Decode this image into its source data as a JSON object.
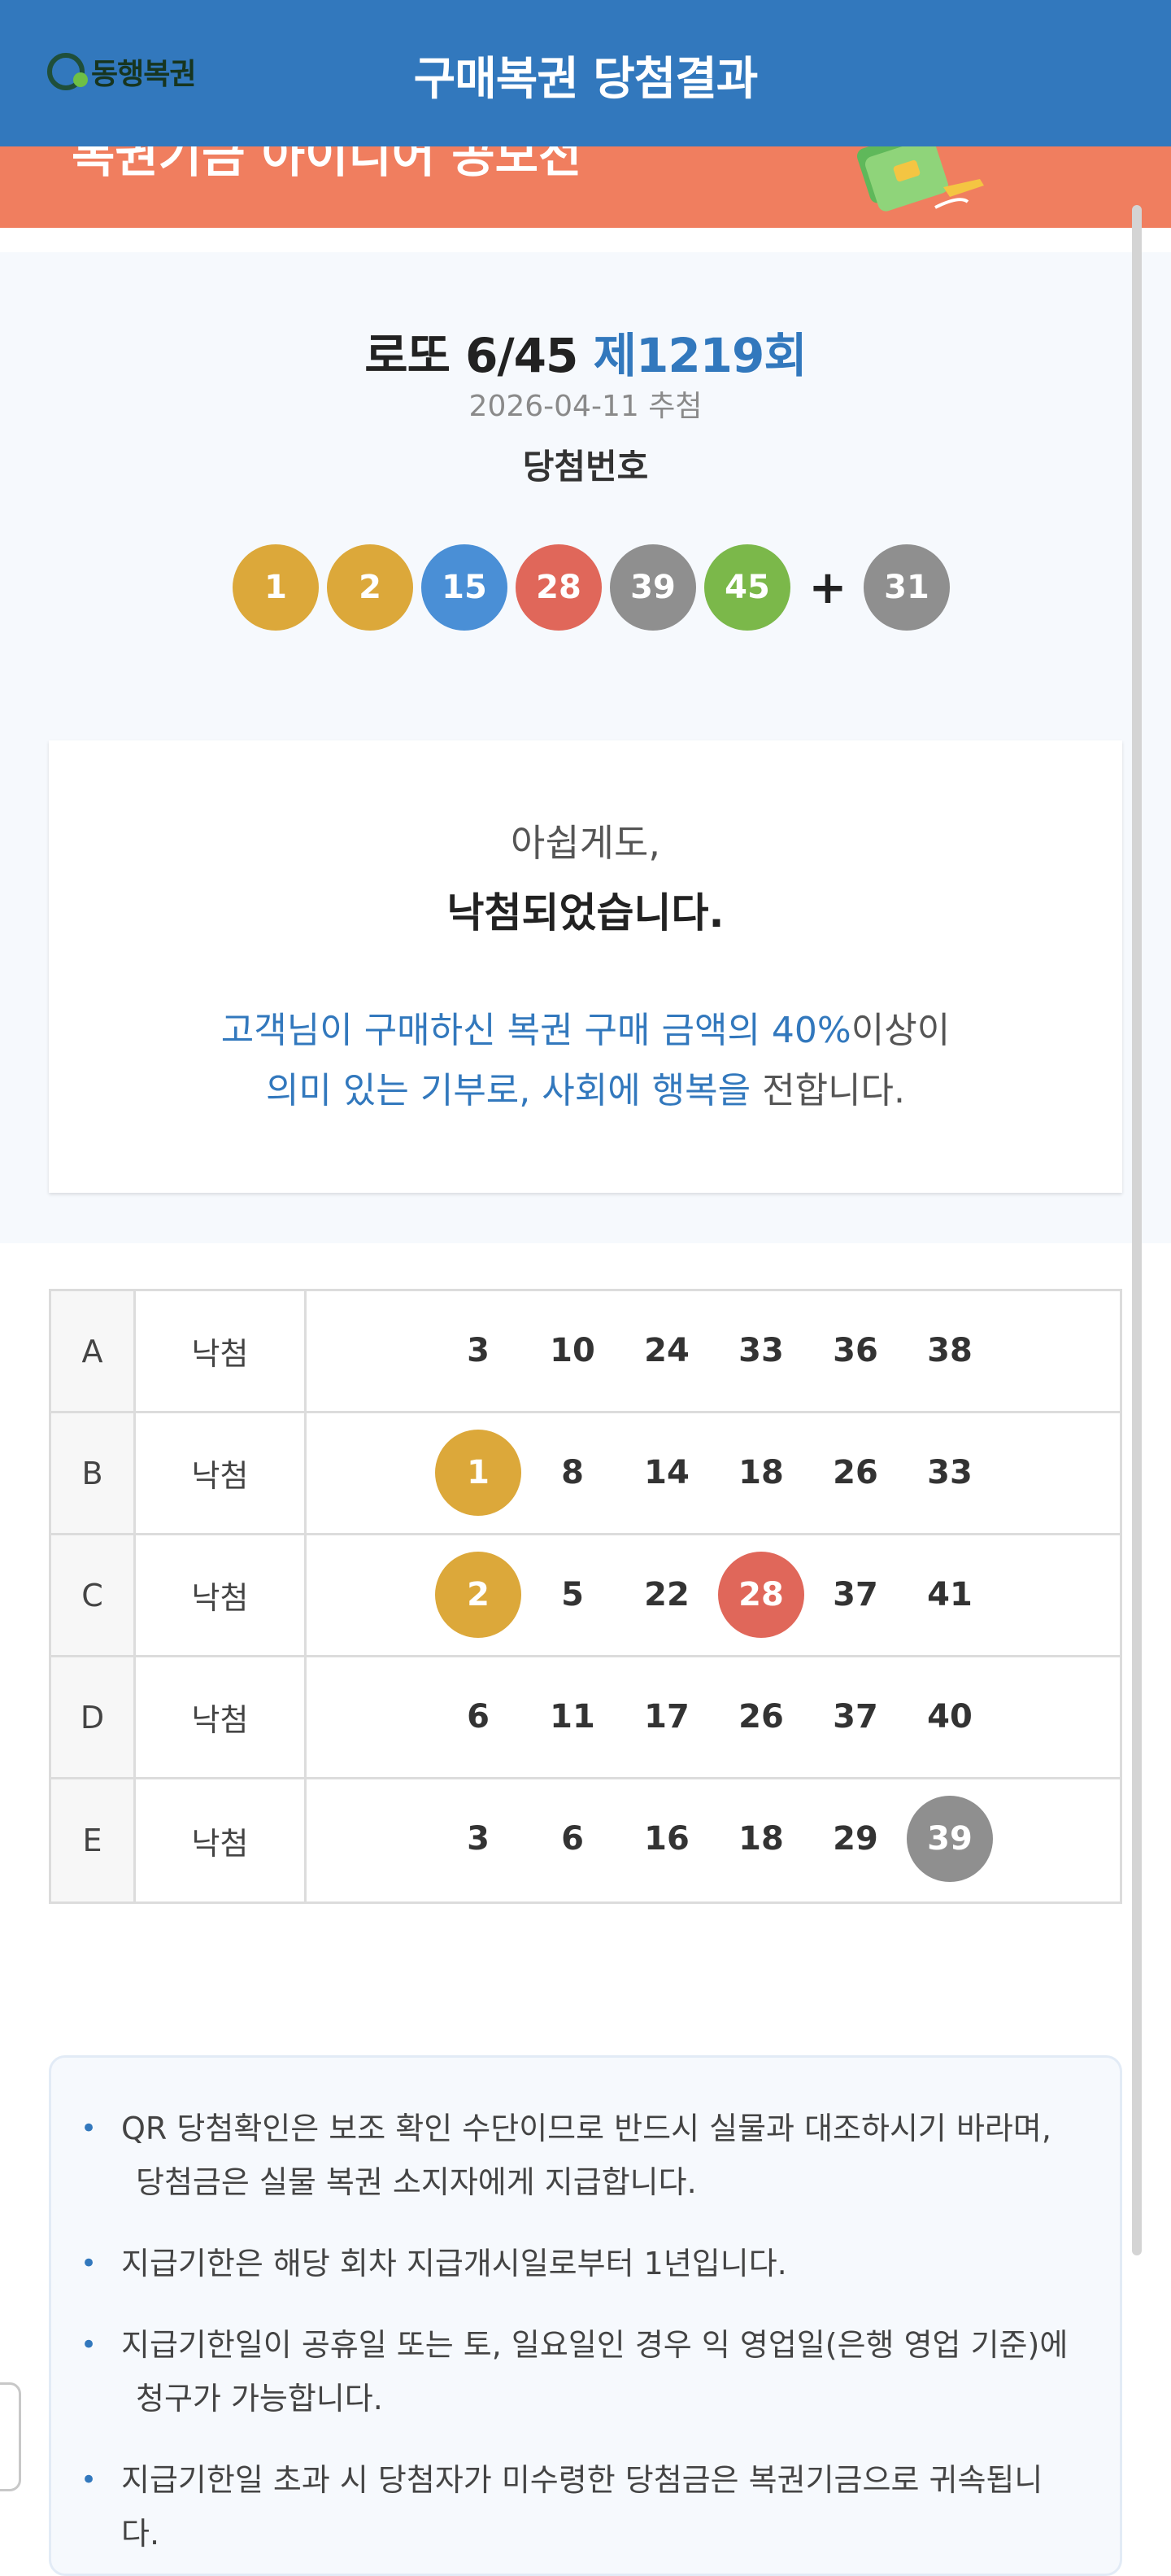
{
  "header": {
    "logo_text": "동행복권",
    "title": "구매복권 당첨결과"
  },
  "banner": {
    "text": "복권기금 아이디어 공모전"
  },
  "draw": {
    "game": "로또 6/45",
    "round": "제1219회",
    "date": "2026-04-11 추첨",
    "label": "당첨번호",
    "numbers": [
      {
        "value": "1",
        "color": "#dca83a"
      },
      {
        "value": "2",
        "color": "#dca83a"
      },
      {
        "value": "15",
        "color": "#4a8fd6"
      },
      {
        "value": "28",
        "color": "#e0675a"
      },
      {
        "value": "39",
        "color": "#8f8f8f"
      },
      {
        "value": "45",
        "color": "#7bb84a"
      }
    ],
    "plus": "+",
    "bonus": {
      "value": "31",
      "color": "#8f8f8f"
    }
  },
  "result": {
    "line1": "아쉽게도,",
    "line2": "낙첨되었습니다.",
    "donation_line1_blue": "고객님이 구매하신 복권 구매 금액의 40%",
    "donation_line1_dark": "이상이",
    "donation_line2_blue": "의미 있는 기부로, 사회에 행복을",
    "donation_line2_dark": " 전합니다."
  },
  "tickets": [
    {
      "label": "A",
      "status": "낙첨",
      "numbers": [
        {
          "value": "3"
        },
        {
          "value": "10"
        },
        {
          "value": "24"
        },
        {
          "value": "33"
        },
        {
          "value": "36"
        },
        {
          "value": "38"
        }
      ]
    },
    {
      "label": "B",
      "status": "낙첨",
      "numbers": [
        {
          "value": "1",
          "color": "#dca83a"
        },
        {
          "value": "8"
        },
        {
          "value": "14"
        },
        {
          "value": "18"
        },
        {
          "value": "26"
        },
        {
          "value": "33"
        }
      ]
    },
    {
      "label": "C",
      "status": "낙첨",
      "numbers": [
        {
          "value": "2",
          "color": "#dca83a"
        },
        {
          "value": "5"
        },
        {
          "value": "22"
        },
        {
          "value": "28",
          "color": "#e0675a"
        },
        {
          "value": "37"
        },
        {
          "value": "41"
        }
      ]
    },
    {
      "label": "D",
      "status": "낙첨",
      "numbers": [
        {
          "value": "6"
        },
        {
          "value": "11"
        },
        {
          "value": "17"
        },
        {
          "value": "26"
        },
        {
          "value": "37"
        },
        {
          "value": "40"
        }
      ]
    },
    {
      "label": "E",
      "status": "낙첨",
      "numbers": [
        {
          "value": "3"
        },
        {
          "value": "6"
        },
        {
          "value": "16"
        },
        {
          "value": "18"
        },
        {
          "value": "29"
        },
        {
          "value": "39",
          "color": "#8f8f8f"
        }
      ]
    }
  ],
  "notices": [
    {
      "line1": "QR 당첨확인은 보조 확인 수단이므로 반드시 실물과 대조하시기 바라며,",
      "line2": "당첨금은 실물 복권 소지자에게 지급합니다."
    },
    {
      "line1": "지급기한은 해당 회차 지급개시일로부터 1년입니다."
    },
    {
      "line1": "지급기한일이 공휴일 또는 토, 일요일인 경우 익 영업일(은행 영업 기준)에",
      "line2": "청구가 가능합니다."
    },
    {
      "line1": "지급기한일 초과 시 당첨자가 미수령한 당첨금은 복권기금으로 귀속됩니다."
    }
  ]
}
